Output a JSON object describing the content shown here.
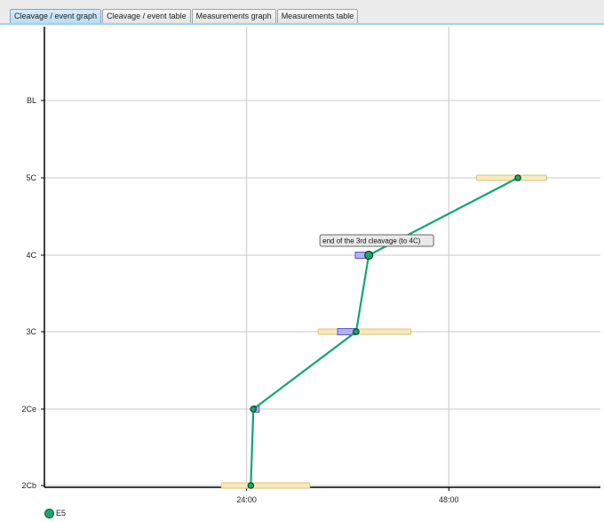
{
  "tabs": [
    {
      "label": "Cleavage / event graph",
      "active": true
    },
    {
      "label": "Cleavage / event table",
      "active": false
    },
    {
      "label": "Measurements graph",
      "active": false
    },
    {
      "label": "Measurements table",
      "active": false
    }
  ],
  "colors": {
    "line": "#11a672",
    "point": "#1aa86a",
    "range_fill": "#f7ebbd",
    "range_stroke": "#d9c27a",
    "interval_fill": "#b4b1f0",
    "interval_stroke": "#5a56c9",
    "grid": "#c8c8c8",
    "axis": "#000000"
  },
  "chart_data": {
    "type": "line",
    "xlim": [
      "0:00",
      "66:00"
    ],
    "x_ticks": [
      "24:00",
      "48:00"
    ],
    "y_categories": [
      "2Cb",
      "2Ce",
      "3C",
      "4C",
      "5C",
      "BL"
    ],
    "grid": true,
    "legend_position": "bottom-left",
    "series": [
      {
        "name": "E5",
        "points": [
          {
            "x": "24:30",
            "y": "2Cb"
          },
          {
            "x": "24:48",
            "y": "2Ce"
          },
          {
            "x": "37:00",
            "y": "3C"
          },
          {
            "x": "38:30",
            "y": "4C"
          },
          {
            "x": "56:12",
            "y": "5C"
          }
        ]
      }
    ],
    "ranges": [
      {
        "y": "2Cb",
        "from": "21:00",
        "to": "31:30"
      },
      {
        "y": "3C",
        "from": "32:30",
        "to": "43:30"
      },
      {
        "y": "5C",
        "from": "51:18",
        "to": "59:36"
      }
    ],
    "intervals": [
      {
        "y": "2Ce",
        "from": "24:48",
        "to": "25:30"
      },
      {
        "y": "3C",
        "from": "34:48",
        "to": "37:00"
      },
      {
        "y": "4C",
        "from": "36:54",
        "to": "38:30"
      }
    ],
    "highlighted_point": {
      "x": "38:30",
      "y": "4C"
    },
    "tooltip": "end of the 3rd cleavage (to 4C)"
  }
}
